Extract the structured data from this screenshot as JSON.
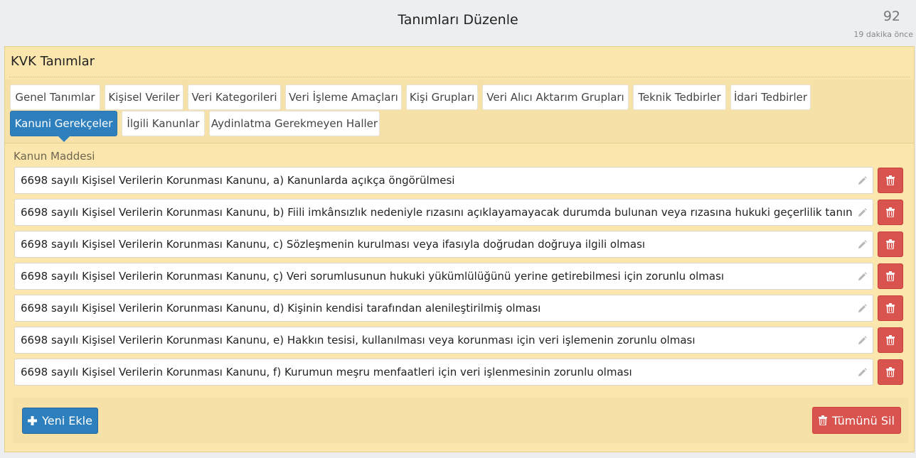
{
  "header": {
    "title": "Tanımları Düzenle",
    "count": "92",
    "updated": "19 dakika önce"
  },
  "panel": {
    "title": "KVK Tanımlar"
  },
  "tabs": [
    "Genel Tanımlar",
    "Kişisel Veriler",
    "Veri Kategorileri",
    "Veri İşleme Amaçları",
    "Kişi Grupları",
    "Veri Alıcı Aktarım Grupları",
    "Teknik Tedbirler",
    "İdari Tedbirler",
    "Kanuni Gerekçeler",
    "İlgili Kanunlar",
    "Aydinlatma Gerekmeyen Haller"
  ],
  "active_tab": "Kanuni Gerekçeler",
  "field": {
    "label": "Kanun Maddesi"
  },
  "items": [
    "6698 sayılı Kişisel Verilerin Korunması Kanunu, a) Kanunlarda açıkça öngörülmesi",
    "6698 sayılı Kişisel Verilerin Korunması Kanunu, b) Fiili imkânsızlık nedeniyle rızasını açıklayamayacak durumda bulunan veya rızasına hukuki geçerlilik tanınmayan",
    "6698 sayılı Kişisel Verilerin Korunması Kanunu, c) Sözleşmenin kurulması veya ifasıyla doğrudan doğruya ilgili olması",
    "6698 sayılı Kişisel Verilerin Korunması Kanunu, ç) Veri sorumlusunun hukuki yükümlülüğünü yerine getirebilmesi için zorunlu olması",
    "6698 sayılı Kişisel Verilerin Korunması Kanunu, d) Kişinin kendisi tarafından alenileştirilmiş olması",
    "6698 sayılı Kişisel Verilerin Korunması Kanunu, e) Hakkın tesisi, kullanılması veya korunması için veri işlemenin zorunlu olması",
    "6698 sayılı Kişisel Verilerin Korunması Kanunu, f) Kurumun meşru menfaatleri için veri işlenmesinin zorunlu olması"
  ],
  "buttons": {
    "add": "Yeni Ekle",
    "delete_all": "Tümünü Sil"
  },
  "colors": {
    "primary": "#2e7fbd",
    "danger": "#d9534f",
    "panel": "#fbe7ae"
  },
  "icons": {
    "edit": "pencil-icon",
    "delete": "trash-icon",
    "add": "plus-icon"
  }
}
